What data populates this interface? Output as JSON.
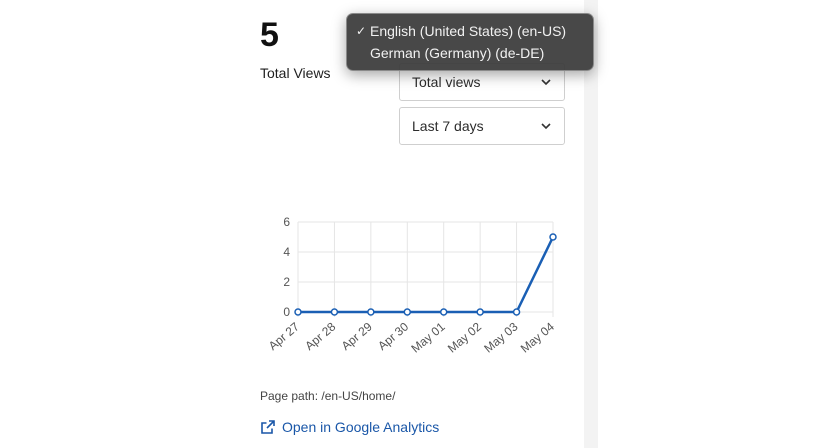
{
  "metric": {
    "value": "5",
    "label": "Total Views"
  },
  "selects": {
    "metric": {
      "value": "Total views"
    },
    "range": {
      "value": "Last 7 days"
    }
  },
  "language_menu": {
    "items": [
      {
        "label": "English (United States) (en-US)",
        "checked": true
      },
      {
        "label": "German (Germany) (de-DE)",
        "checked": false
      }
    ]
  },
  "page_path": "Page path: /en-US/home/",
  "ga_link": "Open in Google Analytics",
  "colors": {
    "line": "#1a5fb4",
    "link": "#1a57a8",
    "grid": "#e5e5e5"
  },
  "chart_data": {
    "type": "line",
    "categories": [
      "Apr 27",
      "Apr 28",
      "Apr 29",
      "Apr 30",
      "May 01",
      "May 02",
      "May 03",
      "May 04"
    ],
    "series": [
      {
        "values": [
          0,
          0,
          0,
          0,
          0,
          0,
          0,
          5
        ]
      }
    ],
    "ylim": [
      0,
      6
    ],
    "yticks": [
      0,
      2,
      4,
      6
    ],
    "grid": true,
    "title": "",
    "xlabel": "",
    "ylabel": ""
  }
}
